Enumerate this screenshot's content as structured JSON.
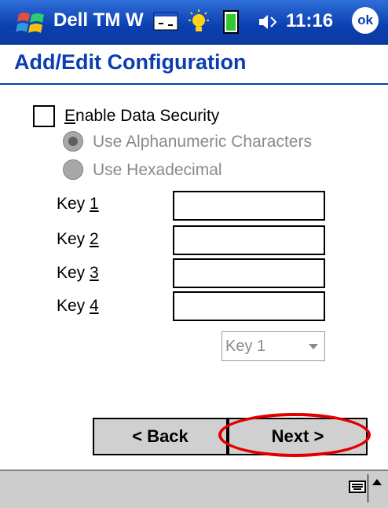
{
  "titlebar": {
    "app_name": "Dell TM W",
    "clock": "11:16",
    "ok_label": "ok"
  },
  "page": {
    "title": "Add/Edit Configuration"
  },
  "security": {
    "enable_label": "Enable Data Security",
    "enable_access_key": "E",
    "enable_checked": false,
    "radio_alnum": "Use Alphanumeric Characters",
    "radio_hex": "Use Hexadecimal"
  },
  "keys": [
    {
      "prefix": "Key ",
      "number": "1",
      "value": ""
    },
    {
      "prefix": "Key ",
      "number": "2",
      "value": ""
    },
    {
      "prefix": "Key ",
      "number": "3",
      "value": ""
    },
    {
      "prefix": "Key ",
      "number": "4",
      "value": ""
    }
  ],
  "key_select": {
    "selected": "Key 1"
  },
  "buttons": {
    "back": "< Back",
    "next": "Next >"
  },
  "colors": {
    "titlebar": "#0a3eb0",
    "highlight": "#e00000"
  },
  "icons": [
    "windows-start-icon",
    "network-icon",
    "light-icon",
    "battery-icon",
    "speaker-icon",
    "keyboard-icon"
  ]
}
